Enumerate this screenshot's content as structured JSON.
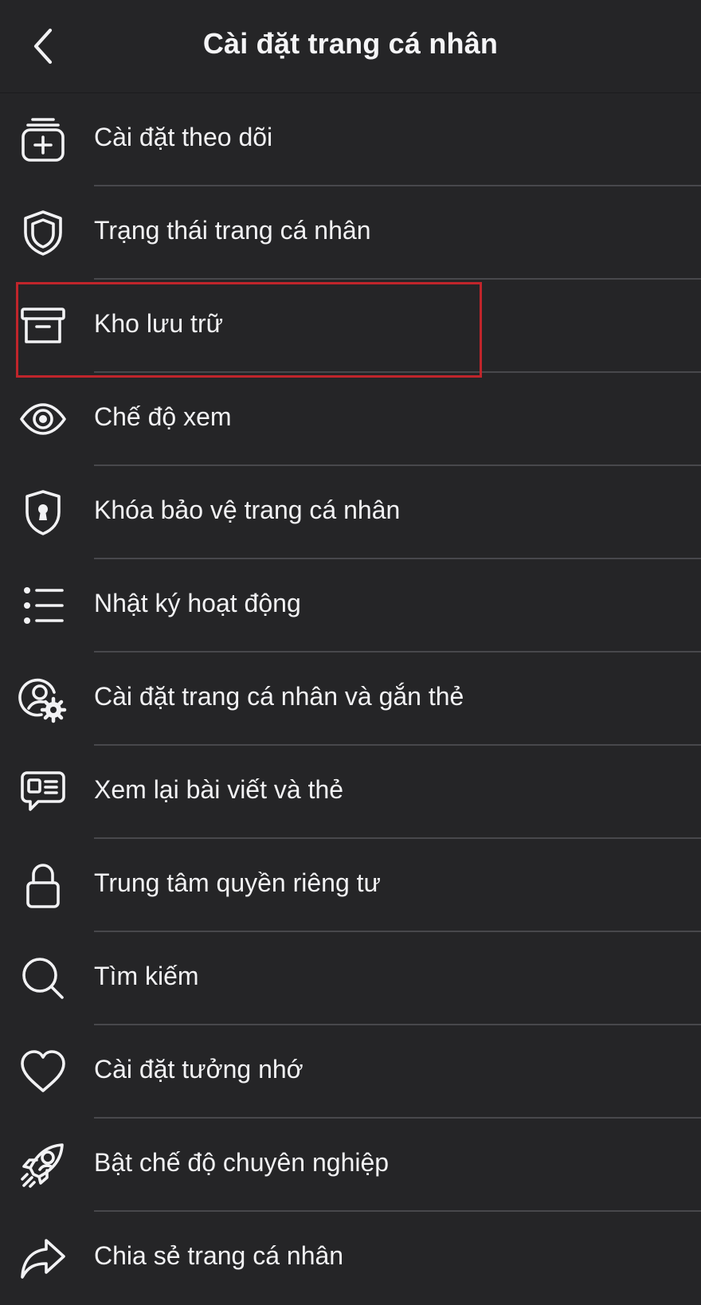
{
  "header": {
    "title": "Cài đặt trang cá nhân",
    "back_icon": "chevron-left-icon"
  },
  "menu": {
    "items": [
      {
        "label": "Cài đặt theo dõi",
        "icon": "follow-settings-icon"
      },
      {
        "label": "Trạng thái trang cá nhân",
        "icon": "shield-icon"
      },
      {
        "label": "Kho lưu trữ",
        "icon": "archive-box-icon"
      },
      {
        "label": "Chế độ xem",
        "icon": "eye-icon"
      },
      {
        "label": "Khóa bảo vệ trang cá nhân",
        "icon": "shield-keyhole-icon"
      },
      {
        "label": "Nhật ký hoạt động",
        "icon": "list-icon"
      },
      {
        "label": "Cài đặt trang cá nhân và gắn thẻ",
        "icon": "user-gear-icon"
      },
      {
        "label": "Xem lại bài viết và thẻ",
        "icon": "post-review-icon"
      },
      {
        "label": "Trung tâm quyền riêng tư",
        "icon": "lock-icon"
      },
      {
        "label": "Tìm kiếm",
        "icon": "search-icon"
      },
      {
        "label": "Cài đặt tưởng nhớ",
        "icon": "heart-icon"
      },
      {
        "label": "Bật chế độ chuyên nghiệp",
        "icon": "professional-mode-icon"
      },
      {
        "label": "Chia sẻ trang cá nhân",
        "icon": "share-arrow-icon"
      }
    ]
  },
  "colors": {
    "background": "#252527",
    "text": "#f2f2f4",
    "divider": "#48484c",
    "highlight": "#c0252b"
  }
}
